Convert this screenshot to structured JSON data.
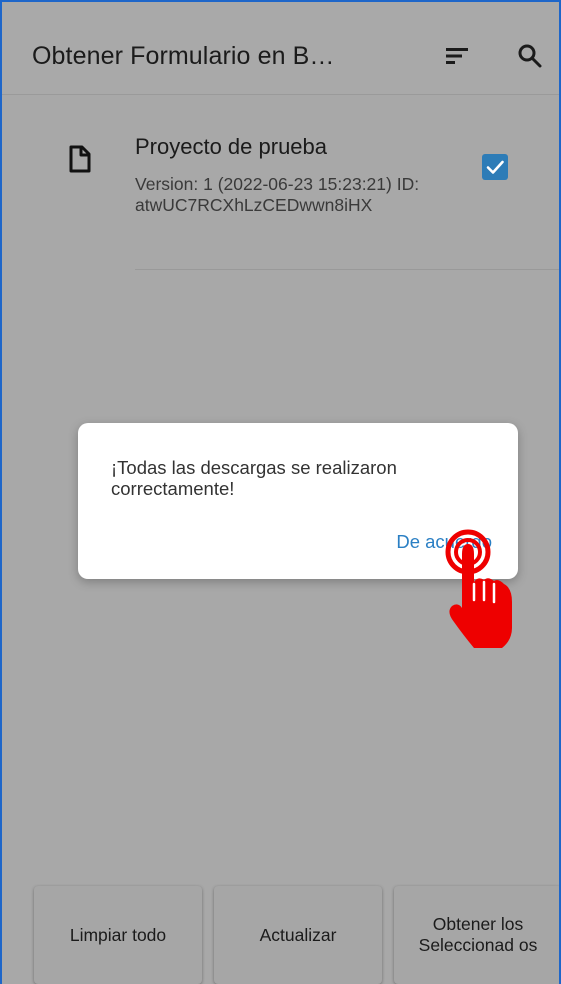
{
  "app_bar": {
    "title": "Obtener Formulario en B…",
    "icons": [
      "sort-icon",
      "search-icon"
    ]
  },
  "form_list": {
    "items": [
      {
        "title": "Proyecto de prueba",
        "details": "Version: 1 (2022-06-23 15:23:21) ID: atwUC7RCXhLzCEDwwn8iHX",
        "checked": true,
        "icon": "file-icon"
      }
    ]
  },
  "dialog": {
    "message": "¡Todas las descargas se realizaron correctamente!",
    "ok_label": "De acuerdo"
  },
  "bottom_bar": {
    "clear_label": "Limpiar todo",
    "refresh_label": "Actualizar",
    "get_selected_label": "Obtener los Seleccionad os"
  },
  "colors": {
    "scrim_background": "#a8a8a8",
    "accent": "#2a7fc4",
    "checkbox": "#2d7cb7",
    "hand_pointer": "#ee0000",
    "frame_border": "#1e66c9"
  }
}
